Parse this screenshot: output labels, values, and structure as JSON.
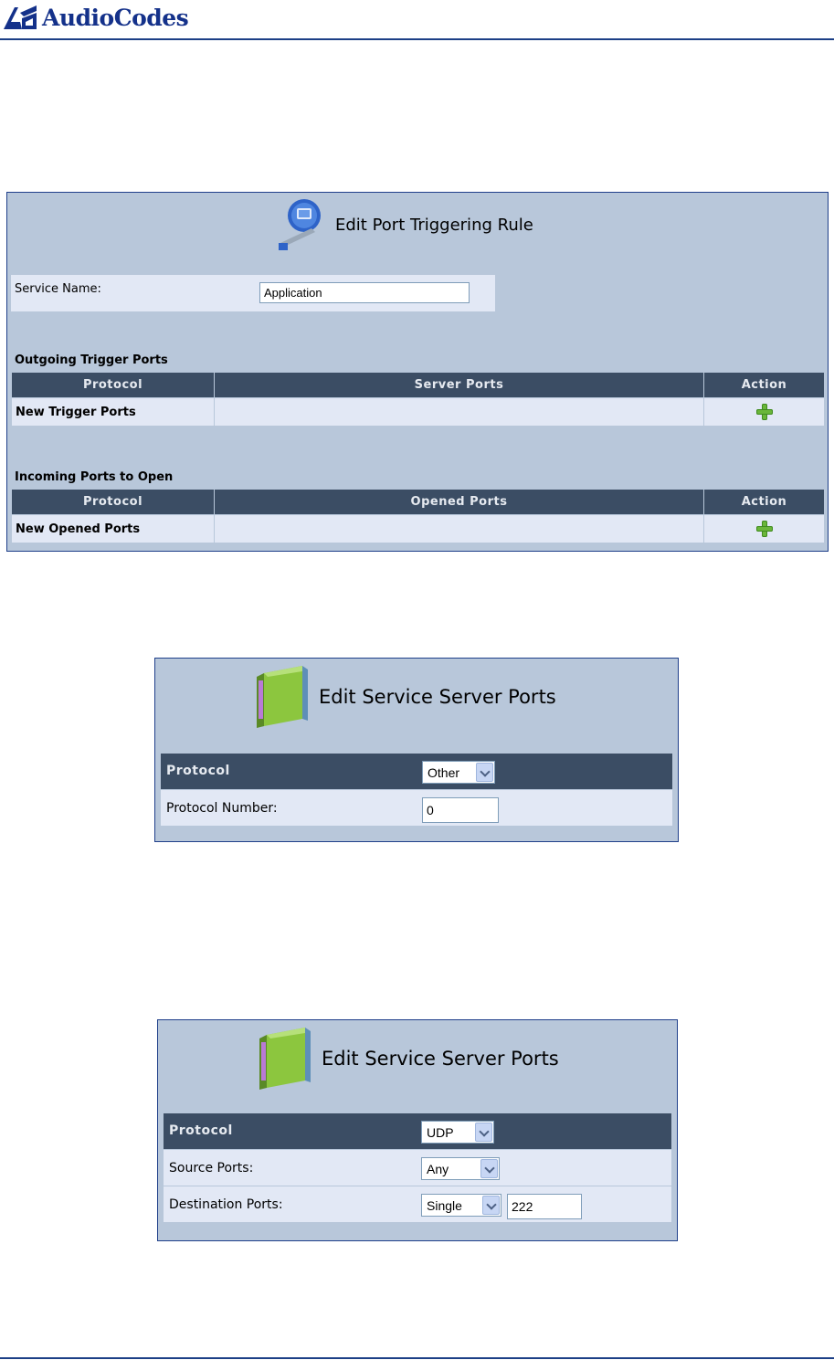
{
  "header": {
    "brand": "AudioCodes"
  },
  "port_triggering": {
    "title": "Edit Port Triggering Rule",
    "service_name_label": "Service Name:",
    "service_name_value": "Application",
    "outgoing": {
      "section_title": "Outgoing Trigger Ports",
      "columns": [
        "Protocol",
        "Server Ports",
        "Action"
      ],
      "row_label": "New Trigger Ports"
    },
    "incoming": {
      "section_title": "Incoming Ports to Open",
      "columns": [
        "Protocol",
        "Opened Ports",
        "Action"
      ],
      "row_label": "New Opened Ports"
    },
    "add_icon": "plus-icon"
  },
  "server_ports_other": {
    "title": "Edit Service Server Ports",
    "protocol_label": "Protocol",
    "protocol_value": "Other",
    "protocol_number_label": "Protocol Number:",
    "protocol_number_value": "0"
  },
  "server_ports_udp": {
    "title": "Edit Service Server Ports",
    "protocol_label": "Protocol",
    "protocol_value": "UDP",
    "source_ports_label": "Source Ports:",
    "source_ports_value": "Any",
    "destination_ports_label": "Destination Ports:",
    "destination_ports_type": "Single",
    "destination_ports_value": "222"
  },
  "colors": {
    "panel_bg": "#b8c7da",
    "header_row": "#3b4d64",
    "row_bg": "#e2e8f5",
    "brand": "#14318a",
    "plus": "#6ab63a"
  }
}
